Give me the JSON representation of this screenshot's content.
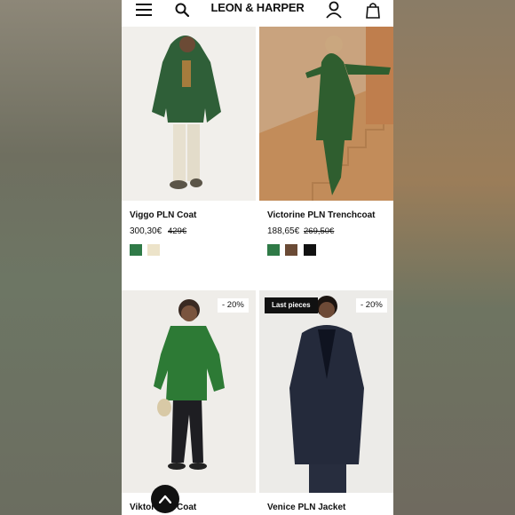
{
  "header": {
    "brand": "LEON & HARPER",
    "menu_icon": "hamburger-menu-icon",
    "search_icon": "search-icon",
    "account_icon": "user-icon",
    "bag_icon": "shopping-bag-icon"
  },
  "products": [
    {
      "name": "Viggo PLN Coat",
      "price": "300,30€",
      "old_price": "429€",
      "swatches": [
        "#2f7a47",
        "#ece3c9"
      ]
    },
    {
      "name": "Victorine PLN Trenchcoat",
      "price": "188,65€",
      "old_price": "269,50€",
      "swatches": [
        "#2f7a47",
        "#6a4a35",
        "#111111"
      ]
    },
    {
      "name_visible": "Viktor",
      "name_suffix": "Coat",
      "badge": "- 20%"
    },
    {
      "name": "Venice PLN Jacket",
      "badge_left": "Last pieces",
      "badge_right": "- 20%"
    }
  ],
  "scroll_top_icon": "chevron-up-icon"
}
